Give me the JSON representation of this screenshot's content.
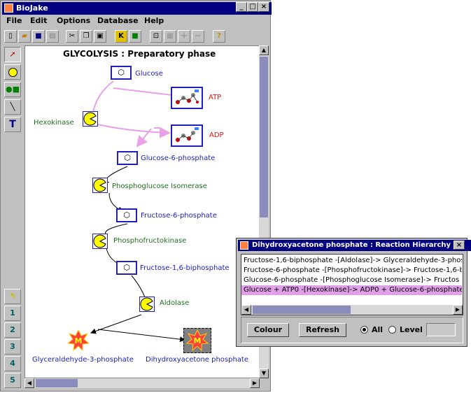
{
  "main_window": {
    "title": "BioJake",
    "menu": [
      "File",
      "Edit",
      "Options",
      "Database",
      "Help"
    ],
    "diagram_title": "GLYCOLYSIS : Preparatory phase",
    "labels": {
      "glucose": "Glucose",
      "atp": "ATP",
      "adp": "ADP",
      "hexokinase": "Hexokinase",
      "g6p": "Glucose-6-phosphate",
      "pgi": "Phosphoglucose Isomerase",
      "f6p": "Fructose-6-phosphate",
      "pfk": "Phosphofructokinase",
      "f16bp": "Fructose-1,6-biphosphate",
      "aldolase": "Aldolase",
      "g3p": "Glyceraldehyde-3-phosphate",
      "dhap": "Dihydroxyacetone phosphate"
    },
    "side_tools": [
      "1",
      "2",
      "3",
      "4",
      "5"
    ]
  },
  "dialog": {
    "title": "Dihydroxyacetone phosphate : Reaction Hierarchy",
    "rows": [
      "Fructose-1,6-biphosphate -[Aldolase]-> Glyceraldehyde-3-phosp",
      "Fructose-6-phosphate -[Phosphofructokinase]-> Fructose-1,6-b",
      "Glucose-6-phosphate -[Phosphoglucose Isomerase]-> Fructos",
      "Glucose + ATP0 -[Hexokinase]-> ADP0 + Glucose-6-phosphate"
    ],
    "colour_button": "Colour",
    "refresh_button": "Refresh",
    "all_label": "All",
    "level_label": "Level",
    "level_value": ""
  },
  "colors": {
    "titlebar": "#000080",
    "selected_row": "#e0a0e8",
    "enzyme_yellow": "#ffff00",
    "arrow_pink": "#e8a0e8"
  }
}
